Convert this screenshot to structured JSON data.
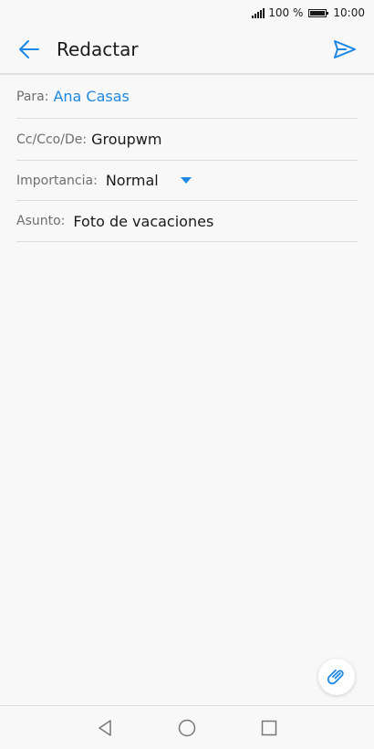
{
  "status_bar": {
    "battery": "100 %",
    "time": "10:00"
  },
  "app_bar": {
    "title": "Redactar",
    "back_icon": "arrow-left-icon",
    "send_icon": "send-icon"
  },
  "form": {
    "to": {
      "label": "Para:",
      "value": "Ana Casas"
    },
    "cc": {
      "label": "Cc/Cco/De:",
      "value": "Groupwm"
    },
    "importance": {
      "label": "Importancia:",
      "value": "Normal"
    },
    "subject": {
      "label": "Asunto:",
      "value": "Foto de vacaciones"
    }
  },
  "attach_icon": "paperclip-icon",
  "nav_bar": {
    "back": "triangle-back-icon",
    "home": "circle-home-icon",
    "recents": "square-recents-icon"
  },
  "colors": {
    "accent": "#1e88e5",
    "background": "#f8f8f8",
    "divider": "#dcdcdc"
  }
}
